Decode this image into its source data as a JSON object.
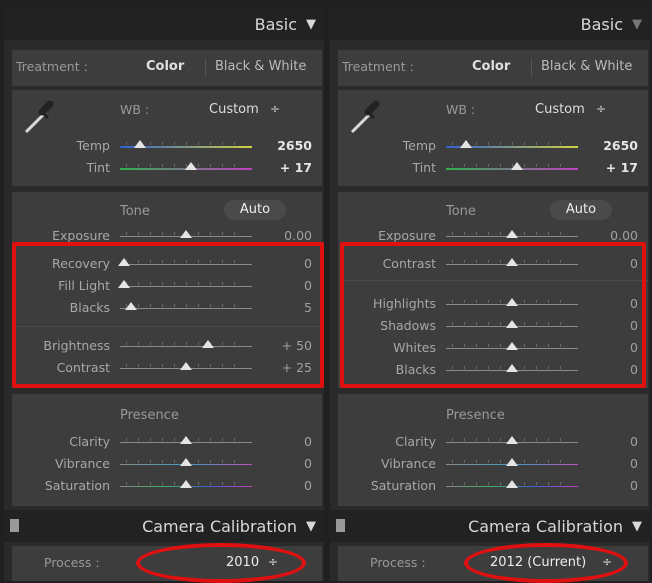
{
  "panels": [
    {
      "basic_header": {
        "title": "Basic",
        "triangle": "▼"
      },
      "treatment": {
        "label": "Treatment :",
        "color": "Color",
        "bw": "Black & White"
      },
      "wb": {
        "label": "WB :",
        "value": "Custom",
        "arrows": "÷"
      },
      "temp": {
        "label": "Temp",
        "value": "2650",
        "pos": 0.15
      },
      "tint": {
        "label": "Tint",
        "value": "+ 17",
        "pos": 0.54
      },
      "tone": {
        "label": "Tone",
        "auto": "Auto"
      },
      "exposure": {
        "label": "Exposure",
        "value": "0.00",
        "pos": 0.5
      },
      "group1": [
        {
          "label": "Recovery",
          "value": "0",
          "pos": 0.03
        },
        {
          "label": "Fill Light",
          "value": "0",
          "pos": 0.03
        },
        {
          "label": "Blacks",
          "value": "5",
          "pos": 0.08
        }
      ],
      "group2": [
        {
          "label": "Brightness",
          "value": "+ 50",
          "pos": 0.67
        },
        {
          "label": "Contrast",
          "value": "+ 25",
          "pos": 0.5
        }
      ],
      "presence": {
        "label": "Presence"
      },
      "presence_items": [
        {
          "label": "Clarity",
          "value": "0",
          "pos": 0.5
        },
        {
          "label": "Vibrance",
          "value": "0",
          "pos": 0.5
        },
        {
          "label": "Saturation",
          "value": "0",
          "pos": 0.5
        }
      ],
      "calibration": {
        "title": "Camera Calibration",
        "triangle": "▼",
        "handle": "▪"
      },
      "process": {
        "label": "Process :",
        "value": "2010",
        "arrows": "÷"
      }
    },
    {
      "basic_header": {
        "title": "Basic",
        "triangle": "▼"
      },
      "treatment": {
        "label": "Treatment :",
        "color": "Color",
        "bw": "Black & White"
      },
      "wb": {
        "label": "WB :",
        "value": "Custom",
        "arrows": "÷"
      },
      "temp": {
        "label": "Temp",
        "value": "2650",
        "pos": 0.15
      },
      "tint": {
        "label": "Tint",
        "value": "+ 17",
        "pos": 0.54
      },
      "tone": {
        "label": "Tone",
        "auto": "Auto"
      },
      "exposure": {
        "label": "Exposure",
        "value": "0.00",
        "pos": 0.5
      },
      "group1": [
        {
          "label": "Contrast",
          "value": "0",
          "pos": 0.5
        }
      ],
      "group2": [
        {
          "label": "Highlights",
          "value": "0",
          "pos": 0.5
        },
        {
          "label": "Shadows",
          "value": "0",
          "pos": 0.5
        },
        {
          "label": "Whites",
          "value": "0",
          "pos": 0.5
        },
        {
          "label": "Blacks",
          "value": "0",
          "pos": 0.5
        }
      ],
      "presence": {
        "label": "Presence"
      },
      "presence_items": [
        {
          "label": "Clarity",
          "value": "0",
          "pos": 0.5
        },
        {
          "label": "Vibrance",
          "value": "0",
          "pos": 0.5
        },
        {
          "label": "Saturation",
          "value": "0",
          "pos": 0.5
        }
      ],
      "calibration": {
        "title": "Camera Calibration",
        "triangle": "▼",
        "handle": "▪"
      },
      "process": {
        "label": "Process :",
        "value": "2012 (Current)",
        "arrows": "÷"
      }
    }
  ],
  "colors": {
    "highlight_red": "#e01010",
    "panel_bg": "#3d3d3d",
    "header_bg": "#222222"
  }
}
